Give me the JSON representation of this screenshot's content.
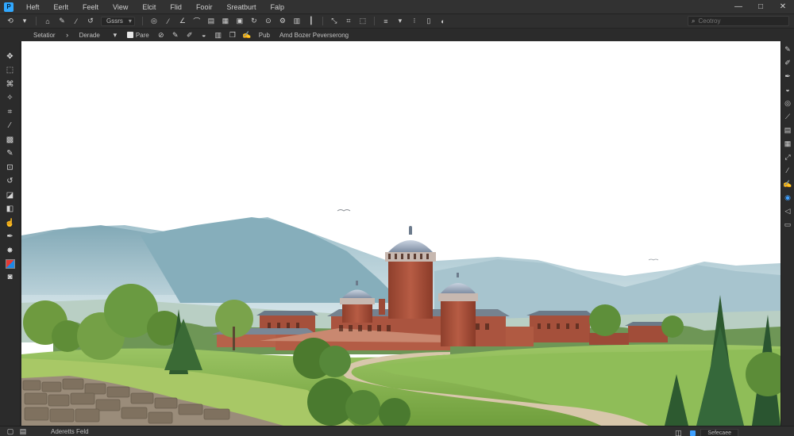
{
  "menubar": {
    "items": [
      "Heft",
      "Eerlt",
      "Feelt",
      "View",
      "Elcit",
      "Flid",
      "Fooir",
      "Sreatburt",
      "Falp"
    ]
  },
  "window_controls": {
    "minimize": "—",
    "maximize": "□",
    "close": "✕"
  },
  "toolbar1": {
    "select_label": "Gssrs",
    "search_placeholder": "Ceotroy"
  },
  "toolbar2": {
    "field1": "Setatior",
    "field2": "Derade",
    "checkbox_label": "Pare",
    "label_a": "Pub",
    "label_b": "Amd Bozer Peverserong"
  },
  "statusbar": {
    "doc_info": "Aderetts Feld",
    "zoom": "Sefecaee"
  },
  "colors": {
    "accent": "#3ea0ff",
    "brick": "#a8513c",
    "sky": "#ffffff",
    "grass": "#7fb548"
  }
}
